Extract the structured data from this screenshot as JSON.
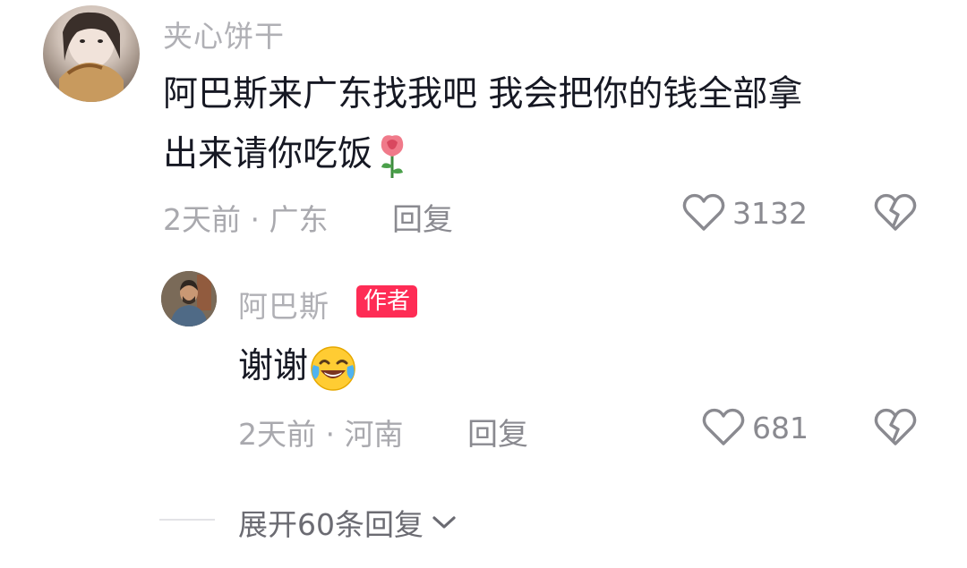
{
  "comment": {
    "username": "夹心饼干",
    "text_line1": "阿巴斯来广东找我吧 我会把你的钱全部拿",
    "text_line2": "出来请你吃饭",
    "emoji": "rose-emoji",
    "meta": "2天前 · 广东",
    "reply_label": "回复",
    "like_count": "3132"
  },
  "reply": {
    "username": "阿巴斯",
    "badge": "作者",
    "text": "谢谢",
    "emoji": "laughing-crying-emoji",
    "meta": "2天前 · 河南",
    "reply_label": "回复",
    "like_count": "681"
  },
  "expand": {
    "label": "展开60条回复"
  },
  "icons": {
    "like": "heart-outline-icon",
    "dislike": "broken-heart-icon",
    "expand": "chevron-down-icon"
  },
  "colors": {
    "author_badge": "#fe2c55",
    "muted_text": "#a9a9ae",
    "primary_text": "#161823"
  }
}
